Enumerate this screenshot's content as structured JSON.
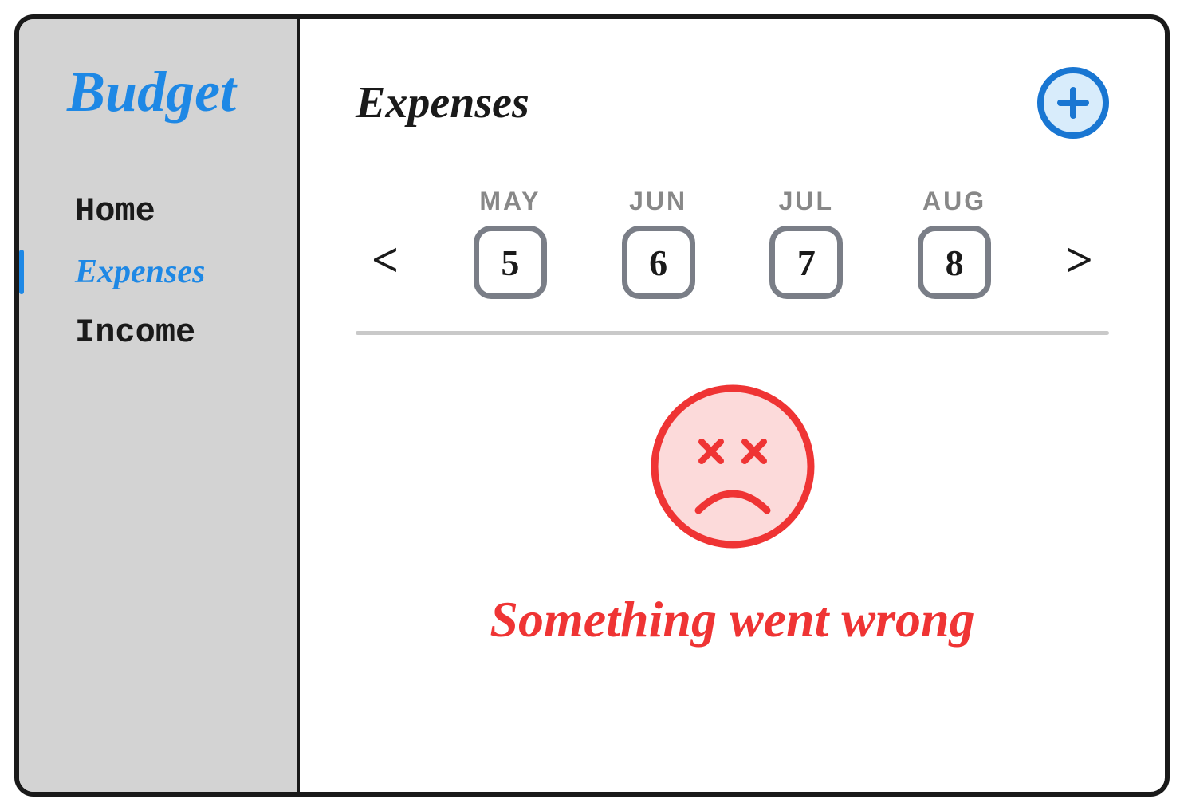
{
  "app": {
    "title": "Budget"
  },
  "sidebar": {
    "items": [
      {
        "label": "Home",
        "active": false
      },
      {
        "label": "Expenses",
        "active": true
      },
      {
        "label": "Income",
        "active": false
      }
    ]
  },
  "main": {
    "title": "Expenses",
    "add_icon": "plus-icon",
    "date_nav": {
      "prev": "<",
      "next": ">",
      "items": [
        {
          "month": "MAY",
          "day": "5"
        },
        {
          "month": "JUN",
          "day": "6"
        },
        {
          "month": "JUL",
          "day": "7"
        },
        {
          "month": "AUG",
          "day": "8"
        }
      ]
    },
    "error": {
      "icon": "sad-face-icon",
      "message": "Something went wrong"
    }
  },
  "colors": {
    "accent": "#1e88e5",
    "error": "#ef3434",
    "border_gray": "#7a7e87"
  }
}
